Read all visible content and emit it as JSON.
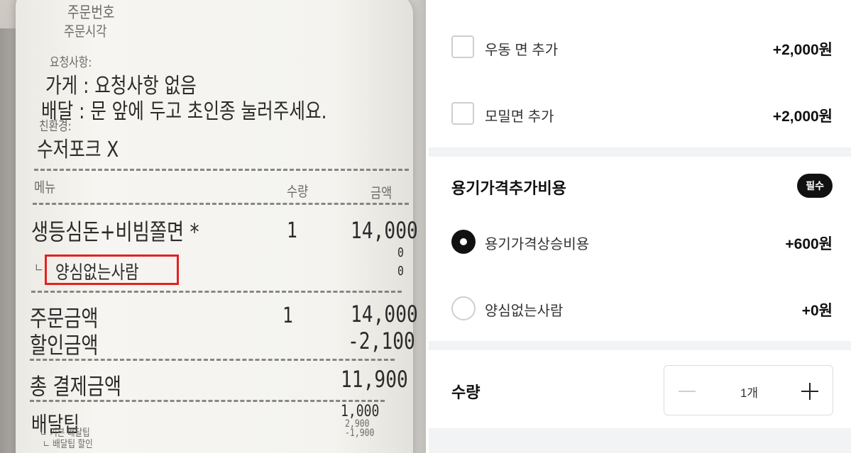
{
  "receipt": {
    "top_scribble_1": "주문번호",
    "top_scribble_2": "주문시각",
    "request_header": "요청사항:",
    "store_request": "가게 : 요청사항 없음",
    "delivery_request": "배달 : 문 앞에 두고 초인종 눌러주세요.",
    "eco_header": "친환경:",
    "utensils": "수저포크 X",
    "col_menu": "메뉴",
    "col_qty": "수량",
    "col_amount": "금액",
    "item_name": "생등심돈+비빔쫄면 *",
    "item_qty": "1",
    "item_amount": "14,000",
    "sub_zero_1": "0",
    "sub_zero_2": "0",
    "sub_prefix": "ㄴ",
    "option_highlighted": "양심없는사람",
    "order_total_label": "주문금액",
    "order_total_qty": "1",
    "order_total_amount": "14,000",
    "discount_label": "할인금액",
    "discount_amount": "-2,100",
    "grand_total_label": "총 결제금액",
    "grand_total_amount": "11,900",
    "delivery_tip_label": "배달팁",
    "delivery_tip_amount": "1,000",
    "basic_tip_label": "ㄴ 기본 배달팁",
    "basic_tip_amount": "2,900",
    "tip_discount_label": "ㄴ 배달팁 할인",
    "tip_discount_amount": "-1,900",
    "highlight_color": "#e22222"
  },
  "app": {
    "options": [
      {
        "label": "우동 면 추가",
        "price": "+2,000원"
      },
      {
        "label": "모밀면 추가",
        "price": "+2,000원"
      }
    ],
    "section": {
      "title": "용기가격추가비용",
      "badge": "필수",
      "choices": [
        {
          "label": "용기가격상승비용",
          "price": "+600원",
          "selected": true
        },
        {
          "label": "양심없는사람",
          "price": "+0원",
          "selected": false
        }
      ]
    },
    "quantity": {
      "label": "수량",
      "value": "1개"
    }
  }
}
